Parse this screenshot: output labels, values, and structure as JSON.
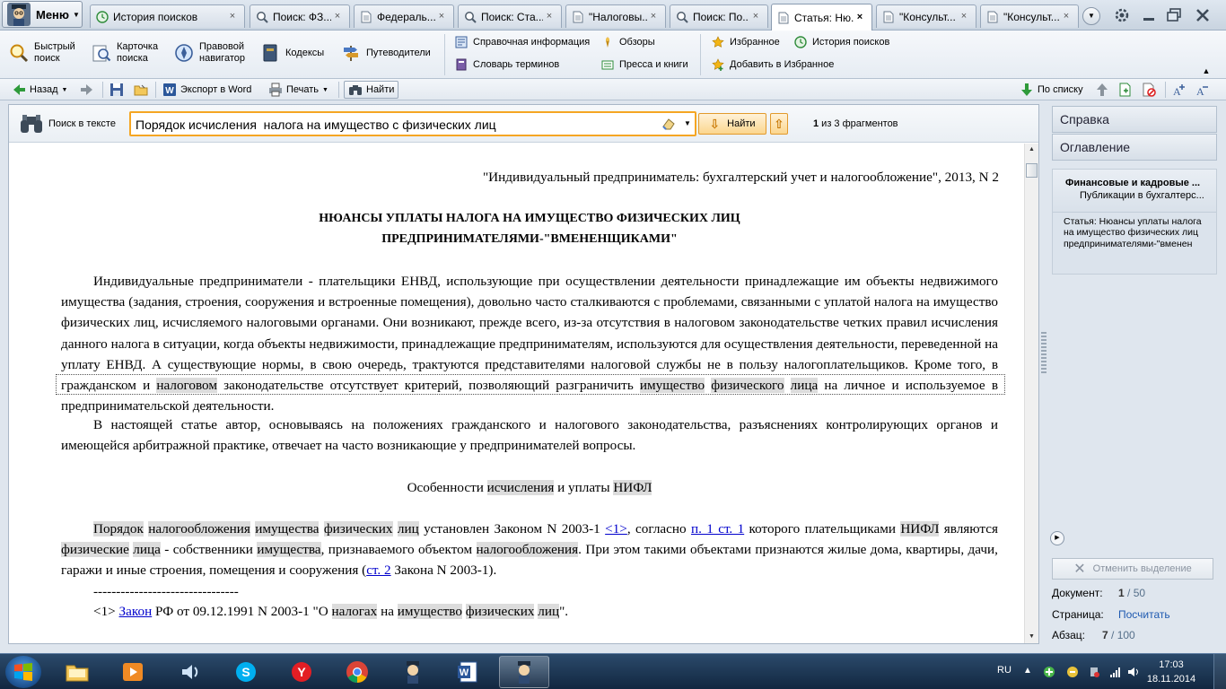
{
  "app": {
    "menu_label": "Меню"
  },
  "tabs": [
    {
      "label": "История поисков",
      "icon": "history-icon",
      "active": false
    },
    {
      "label": "Поиск: ФЗ...",
      "icon": "search-icon",
      "active": false
    },
    {
      "label": "Федераль...",
      "icon": "document-icon",
      "active": false
    },
    {
      "label": "Поиск: Ста...",
      "icon": "search-icon",
      "active": false
    },
    {
      "label": "\"Налоговы...",
      "icon": "document-icon",
      "active": false
    },
    {
      "label": "Поиск: По...",
      "icon": "search-icon",
      "active": false
    },
    {
      "label": "Статья: Ню...",
      "icon": "document-icon",
      "active": true
    },
    {
      "label": "\"Консульт...",
      "icon": "document-icon",
      "active": false
    },
    {
      "label": "\"Консульт...",
      "icon": "document-icon",
      "active": false
    }
  ],
  "ribbon": {
    "quick_search": "Быстрый\nпоиск",
    "card_search": "Карточка\nпоиска",
    "legal_navigator": "Правовой\nнавигатор",
    "codes": "Кодексы",
    "guides": "Путеводители",
    "reference_info": "Справочная информация",
    "glossary": "Словарь терминов",
    "reviews": "Обзоры",
    "press_books": "Пресса и книги",
    "favorites": "Избранное",
    "add_favorites": "Добавить в Избранное",
    "search_history": "История поисков"
  },
  "navbar": {
    "back": "Назад",
    "export_word": "Экспорт в Word",
    "print": "Печать",
    "find": "Найти",
    "by_list": "По списку"
  },
  "search": {
    "label": "Поиск в тексте",
    "value": "Порядок исчисления  налога на имущество с физических лиц",
    "find_button": "Найти",
    "count_current": "1",
    "count_rest": " из 3 фрагментов"
  },
  "document": {
    "source": "\"Индивидуальный предприниматель: бухгалтерский учет и налогообложение\", 2013, N 2",
    "title_line1": "НЮАНСЫ УПЛАТЫ НАЛОГА НА ИМУЩЕСТВО ФИЗИЧЕСКИХ ЛИЦ",
    "title_line2": "ПРЕДПРИНИМАТЕЛЯМИ-\"ВМЕНЕНЩИКАМИ\"",
    "para1_a": "Индивидуальные предприниматели - плательщики ЕНВД, использующие при осуществлении деятельности принадлежащие им объекты недвижимого имущества (задания, строения, сооружения и встроенные помещения), довольно часто сталкиваются с проблемами, связанными с уплатой налога на имущество физических лиц, исчисляемого налоговыми органами. Они возникают, прежде всего, из-за отсутствия в налоговом законодательстве четких правил исчисления данного налога в ситуации, когда объекты недвижимости, принадлежащие предпринимателям, используются для осуществления деятельности, переведенной на уплату ЕНВД. А существующие нормы, в свою очередь, трактуются представителями налоговой службы не в пользу налогоплательщиков. Кроме того, в гражданском и ",
    "para1_hl1": "налоговом",
    "para1_b": " законодательстве отсутствует критерий, позволяющий разграничить ",
    "para1_hl2": "имущество",
    "para1_hl3": "физического",
    "para1_hl4": "лица",
    "para1_c": " на личное и используемое в предпринимательской деятельности.",
    "para2": "В настоящей статье автор, основываясь на положениях гражданского и налогового законодательства, разъяснениях контролирующих органов и имеющейся арбитражной практике, отвечает на часто возникающие у предпринимателей вопросы.",
    "sub_a": "Особенности ",
    "sub_hl1": "исчисления",
    "sub_b": " и уплаты ",
    "sub_hl2": "НИФЛ",
    "p3_hl1": "Порядок",
    "p3_hl2": "налогообложения",
    "p3_hl3": "имущества",
    "p3_hl4": "физических",
    "p3_hl5": "лиц",
    "p3_a": " установлен Законом N 2003-1 ",
    "p3_link1": "<1>",
    "p3_b": ", согласно ",
    "p3_link2": "п. 1 ст. 1",
    "p3_c": " которого плательщиками ",
    "p3_hl6": "НИФЛ",
    "p3_d": " являются ",
    "p3_hl7": "физические",
    "p3_hl8": "лица",
    "p3_e": " - собственники ",
    "p3_hl9": "имущества",
    "p3_f": ", признаваемого объектом ",
    "p3_hl10": "налогообложения",
    "p3_g": ". При этом такими объектами признаются жилые дома, квартиры, дачи, гаражи и иные строения, помещения и сооружения (",
    "p3_link3": "ст. 2",
    "p3_h": " Закона N 2003-1).",
    "footnote_sep": "--------------------------------",
    "fn_a": "<1> ",
    "fn_link": "Закон",
    "fn_b": " РФ от 09.12.1991 N 2003-1 \"О ",
    "fn_hl1": "налогах",
    "fn_c": " на ",
    "fn_hl2": "имущество",
    "fn_hl3": "физических",
    "fn_hl4": "лиц",
    "fn_d": "\"."
  },
  "right_pane": {
    "help": "Справка",
    "contents": "Оглавление",
    "card_title": "Финансовые и кадровые ...",
    "card_subtitle": "Публикации в бухгалтерс...",
    "card_body_label": "Статья:",
    "card_body": " Нюансы уплаты налога на имущество физических лиц предпринимателями-\"вменен",
    "clear_selection": "Отменить выделение",
    "doc_label": "Документ:",
    "doc_current": "1",
    "doc_total": " / 50",
    "page_label": "Страница:",
    "page_link": "Посчитать",
    "para_label": "Абзац:",
    "para_current": "7",
    "para_total": " / 100"
  },
  "taskbar": {
    "lang": "RU",
    "time": "17:03",
    "date": "18.11.2014"
  },
  "colors": {
    "search_border": "#f5a623",
    "highlight": "#dcdcdc",
    "link": "#0000cc",
    "taskbar": "#1c3552"
  }
}
